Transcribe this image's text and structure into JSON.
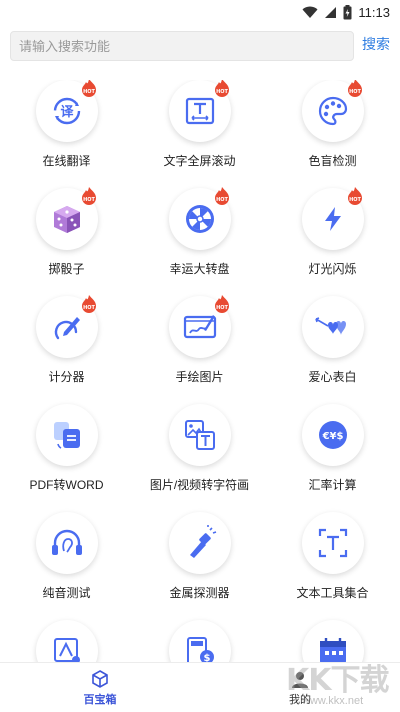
{
  "status_bar": {
    "time": "11:13",
    "icons": [
      "wifi-icon",
      "signal-icon",
      "battery-charging-icon"
    ]
  },
  "search": {
    "placeholder": "请输入搜索功能",
    "value": "",
    "button_label": "搜索"
  },
  "tools": [
    {
      "label": "在线翻译",
      "icon": "translate-icon",
      "hot": true
    },
    {
      "label": "文字全屏滚动",
      "icon": "text-scroll-icon",
      "hot": true
    },
    {
      "label": "色盲检测",
      "icon": "palette-icon",
      "hot": true
    },
    {
      "label": "掷骰子",
      "icon": "dice-icon",
      "hot": true
    },
    {
      "label": "幸运大转盘",
      "icon": "wheel-icon",
      "hot": true
    },
    {
      "label": "灯光闪烁",
      "icon": "lightning-icon",
      "hot": true
    },
    {
      "label": "计分器",
      "icon": "score-pen-icon",
      "hot": true
    },
    {
      "label": "手绘图片",
      "icon": "drawing-board-icon",
      "hot": true
    },
    {
      "label": "爱心表白",
      "icon": "hearts-icon",
      "hot": false
    },
    {
      "label": "PDF转WORD",
      "icon": "pdf-convert-icon",
      "hot": false
    },
    {
      "label": "图片/视频转字符画",
      "icon": "image-to-text-icon",
      "hot": false
    },
    {
      "label": "汇率计算",
      "icon": "currency-icon",
      "hot": false
    },
    {
      "label": "纯音测试",
      "icon": "headphone-icon",
      "hot": false
    },
    {
      "label": "金属探测器",
      "icon": "metal-detector-icon",
      "hot": false
    },
    {
      "label": "文本工具集合",
      "icon": "text-tools-icon",
      "hot": false
    },
    {
      "label": "",
      "icon": "image-edit-icon",
      "hot": false
    },
    {
      "label": "",
      "icon": "calculator-money-icon",
      "hot": false
    },
    {
      "label": "",
      "icon": "calendar-icon",
      "hot": false
    }
  ],
  "bottom_nav": {
    "items": [
      {
        "label": "百宝箱",
        "icon": "cube-icon",
        "active": true
      },
      {
        "label": "我的",
        "icon": "person-icon",
        "active": false
      }
    ]
  },
  "watermark": {
    "logo": "KK下载",
    "url": "www.kkx.net"
  },
  "colors": {
    "accent": "#3c55d8",
    "icon_blue": "#4a6cf0",
    "search_link": "#2f7de1",
    "hot_badge": "#e84a32"
  }
}
